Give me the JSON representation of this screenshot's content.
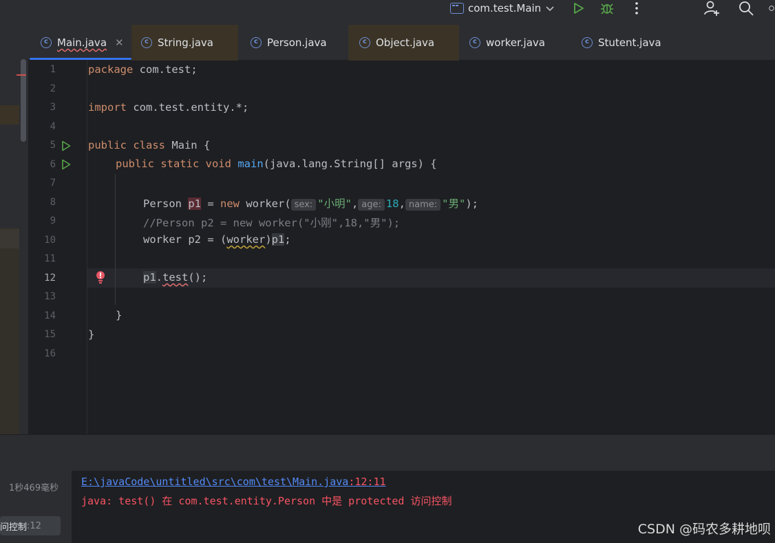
{
  "toolbar": {
    "run_config": "com.test.Main",
    "icons": [
      "window-icon",
      "chevron-down-icon",
      "run-icon",
      "debug-icon",
      "more-icon",
      "add-user-icon",
      "search-icon",
      "settings-icon"
    ]
  },
  "tabs": [
    {
      "label": "Main.java",
      "active": true
    },
    {
      "label": "String.java"
    },
    {
      "label": "Person.java"
    },
    {
      "label": "Object.java"
    },
    {
      "label": "worker.java"
    },
    {
      "label": "Stutent.java"
    }
  ],
  "editor": {
    "line_numbers": [
      "1",
      "2",
      "3",
      "4",
      "5",
      "6",
      "7",
      "8",
      "9",
      "10",
      "11",
      "12",
      "13",
      "14",
      "15",
      "16"
    ],
    "current_line": 12,
    "lines": {
      "l1_kw": "package",
      "l1_rest": " com.test;",
      "l3_kw": "import",
      "l3_rest": " com.test.entity.*;",
      "l5_kw": "public class",
      "l5_rest": " Main {",
      "l6_kw": "public static void",
      "l6_fn": "main",
      "l6_rest": "(java.lang.String[] args) {",
      "l8_type": "Person ",
      "l8_var": "p1",
      "l8_eq": " = ",
      "l8_new": "new",
      "l8_ctor": " worker(",
      "l8_hint1": "sex:",
      "l8_arg1": "\"小明\"",
      "l8_comma1": ",",
      "l8_hint2": "age:",
      "l8_arg2": "18",
      "l8_comma2": ",",
      "l8_hint3": "name:",
      "l8_arg3": "\"男\"",
      "l8_end": ");",
      "l9_comment": "//Person p2 = new worker(\"小刚\",18,\"男\");",
      "l10_a": "worker p2 = (",
      "l10_cast": "worker",
      "l10_b": ")",
      "l10_var": "p1",
      "l10_c": ";",
      "l12_var": "p1",
      "l12_dot": ".",
      "l12_call": "test",
      "l12_end": "();",
      "l14": "}",
      "l15": "}"
    }
  },
  "bottom": {
    "elapsed": "1秒469毫秒",
    "message_item_text": "问控制",
    "message_item_line": " :12",
    "file_link": "E:\\javaCode\\untitled\\src\\com\\test\\Main.java",
    "file_pos": ":12:11",
    "error_text": "java: test() 在 com.test.entity.Person 中是 protected 访问控制"
  },
  "watermark": "CSDN @码农多耕地呗"
}
